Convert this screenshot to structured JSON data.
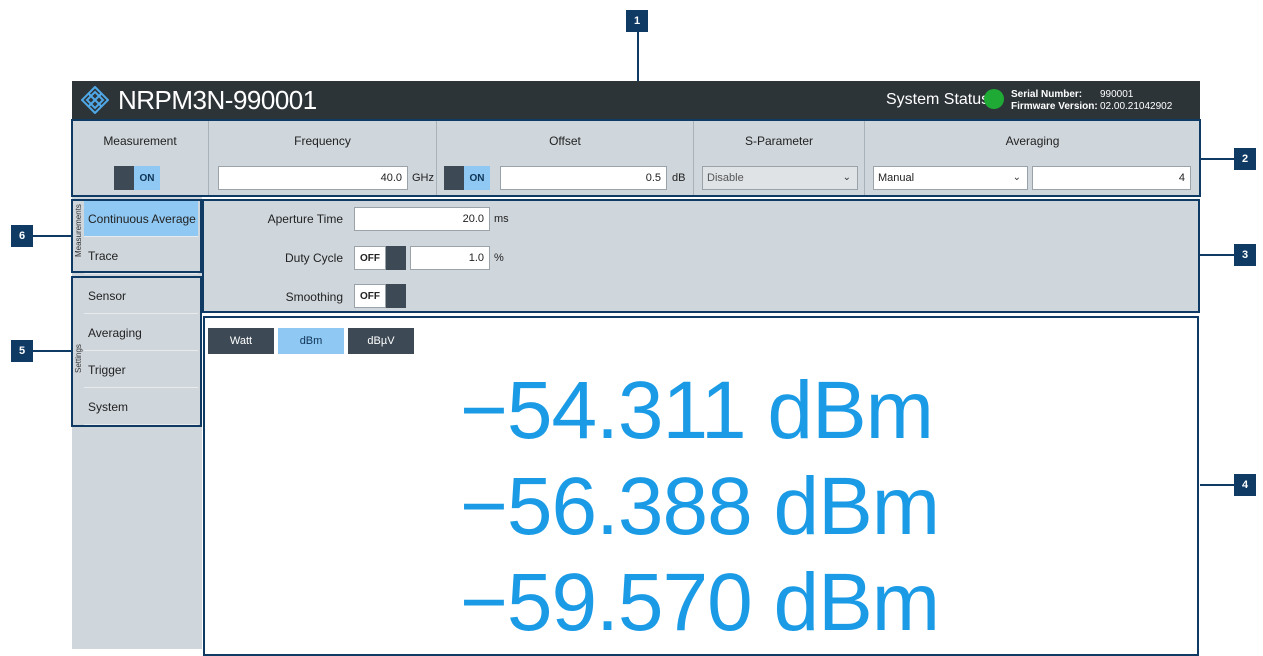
{
  "callouts": [
    "1",
    "2",
    "3",
    "4",
    "5",
    "6"
  ],
  "header": {
    "title": "NRPM3N-990001",
    "system_status_label": "System Status",
    "status_color": "#1fa935",
    "serial_label": "Serial Number:",
    "serial_value": "990001",
    "firmware_label": "Firmware Version:",
    "firmware_value": "02.00.21042902",
    "logo_icon": "rohde-schwarz-logo-icon"
  },
  "toolbar": {
    "measurement": {
      "label": "Measurement",
      "state": "ON"
    },
    "frequency": {
      "label": "Frequency",
      "value": "40.0",
      "unit": "GHz"
    },
    "offset": {
      "label": "Offset",
      "state": "ON",
      "value": "0.5",
      "unit": "dB"
    },
    "sparameter": {
      "label": "S-Parameter",
      "value": "Disable"
    },
    "averaging": {
      "label": "Averaging",
      "mode": "Manual",
      "count": "4"
    }
  },
  "sidebar": {
    "measurements_label": "Measurements",
    "measurements": [
      "Continuous Average",
      "Trace"
    ],
    "settings_label": "Settings",
    "settings": [
      "Sensor",
      "Averaging",
      "Trigger",
      "System"
    ]
  },
  "settings_panel": {
    "aperture": {
      "label": "Aperture Time",
      "value": "20.0",
      "unit": "ms"
    },
    "duty_cycle": {
      "label": "Duty Cycle",
      "state": "OFF",
      "value": "1.0",
      "unit": "%"
    },
    "smoothing": {
      "label": "Smoothing",
      "state": "OFF"
    }
  },
  "display": {
    "unit_tabs": [
      "Watt",
      "dBm",
      "dBµV"
    ],
    "selected_unit": "dBm",
    "readings": [
      "−54.311 dBm",
      "−56.388 dBm",
      "−59.570 dBm"
    ]
  },
  "colors": {
    "accent": "#1b9be6",
    "selected": "#8fc8f2",
    "dark": "#2d3438",
    "panel": "#cfd6dc",
    "callout": "#0f3a64"
  }
}
